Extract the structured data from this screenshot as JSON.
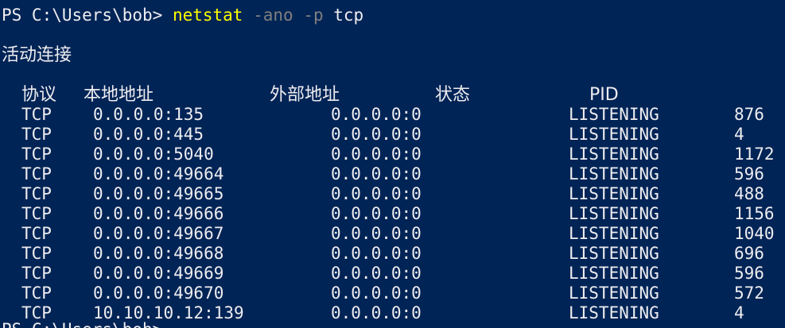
{
  "prompt": {
    "prefix": "PS C:\\Users\\bob> ",
    "command": "netstat",
    "flag1": " -ano",
    "flag2": " -p",
    "arg": " tcp"
  },
  "heading": "活动连接",
  "columns": {
    "proto": "协议",
    "local": "本地地址",
    "foreign": "外部地址",
    "state": "状态",
    "pid": "PID"
  },
  "rows": [
    {
      "proto": "TCP",
      "local": "0.0.0.0:135",
      "foreign": "0.0.0.0:0",
      "state": "LISTENING",
      "pid": "876"
    },
    {
      "proto": "TCP",
      "local": "0.0.0.0:445",
      "foreign": "0.0.0.0:0",
      "state": "LISTENING",
      "pid": "4"
    },
    {
      "proto": "TCP",
      "local": "0.0.0.0:5040",
      "foreign": "0.0.0.0:0",
      "state": "LISTENING",
      "pid": "1172"
    },
    {
      "proto": "TCP",
      "local": "0.0.0.0:49664",
      "foreign": "0.0.0.0:0",
      "state": "LISTENING",
      "pid": "596"
    },
    {
      "proto": "TCP",
      "local": "0.0.0.0:49665",
      "foreign": "0.0.0.0:0",
      "state": "LISTENING",
      "pid": "488"
    },
    {
      "proto": "TCP",
      "local": "0.0.0.0:49666",
      "foreign": "0.0.0.0:0",
      "state": "LISTENING",
      "pid": "1156"
    },
    {
      "proto": "TCP",
      "local": "0.0.0.0:49667",
      "foreign": "0.0.0.0:0",
      "state": "LISTENING",
      "pid": "1040"
    },
    {
      "proto": "TCP",
      "local": "0.0.0.0:49668",
      "foreign": "0.0.0.0:0",
      "state": "LISTENING",
      "pid": "696"
    },
    {
      "proto": "TCP",
      "local": "0.0.0.0:49669",
      "foreign": "0.0.0.0:0",
      "state": "LISTENING",
      "pid": "596"
    },
    {
      "proto": "TCP",
      "local": "0.0.0.0:49670",
      "foreign": "0.0.0.0:0",
      "state": "LISTENING",
      "pid": "572"
    },
    {
      "proto": "TCP",
      "local": "10.10.10.12:139",
      "foreign": "0.0.0.0:0",
      "state": "LISTENING",
      "pid": "4"
    }
  ],
  "next_prompt": "PS C:\\Users\\bob> ",
  "colors": {
    "background": "#012456",
    "foreground": "#eeedf0",
    "command": "#ffff00",
    "parameter": "#7f7f7f"
  }
}
